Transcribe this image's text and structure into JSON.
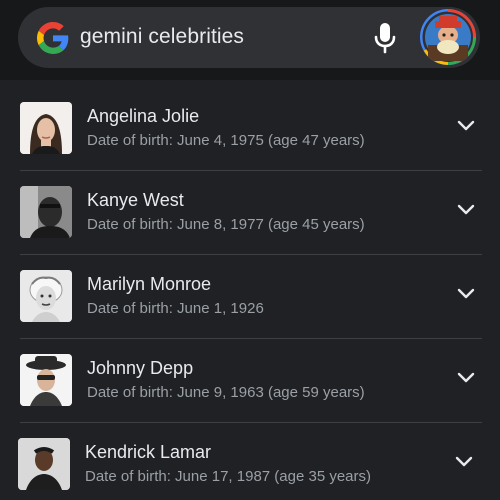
{
  "search": {
    "query": "gemini celebrities",
    "logo_icon": "google-g-icon",
    "mic_icon": "microphone-icon",
    "avatar_icon": "user-avatar"
  },
  "results": [
    {
      "name": "Angelina Jolie",
      "detail": "Date of birth: June 4, 1975 (age 47 years)",
      "expand_icon": "chevron-down-icon"
    },
    {
      "name": "Kanye West",
      "detail": "Date of birth: June 8, 1977 (age 45 years)",
      "expand_icon": "chevron-down-icon"
    },
    {
      "name": "Marilyn Monroe",
      "detail": "Date of birth: June 1, 1926",
      "expand_icon": "chevron-down-icon"
    },
    {
      "name": "Johnny Depp",
      "detail": "Date of birth: June 9, 1963 (age 59 years)",
      "expand_icon": "chevron-down-icon"
    },
    {
      "name": "Kendrick Lamar",
      "detail": "Date of birth: June 17, 1987 (age 35 years)",
      "expand_icon": "chevron-down-icon"
    }
  ],
  "colors": {
    "background": "#202124",
    "search_bar": "#303134",
    "text_primary": "#e8eaed",
    "text_secondary": "#9aa0a6",
    "divider": "#3c4043"
  }
}
